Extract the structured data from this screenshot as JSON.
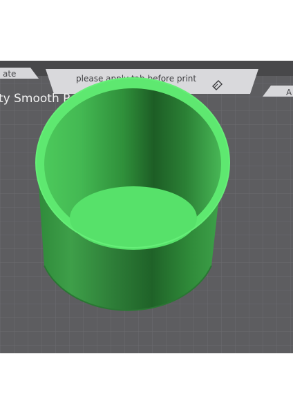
{
  "toolbar": {
    "left_tab_label": "ate",
    "center_notice": "please apply tab before print",
    "right_tab_label": "A"
  },
  "plate": {
    "label": "ty Smooth P"
  },
  "icons": {
    "notice_icon": "eraser-icon"
  },
  "colors": {
    "plate_background": "#5e5e60",
    "grid_line": "#6e6e71",
    "toolbar_bar": "#48484a",
    "tab_fill": "#d9d9dc",
    "model_light": "#5ce36e",
    "model_mid": "#3fb04c",
    "model_dark": "#1f6e2a"
  }
}
